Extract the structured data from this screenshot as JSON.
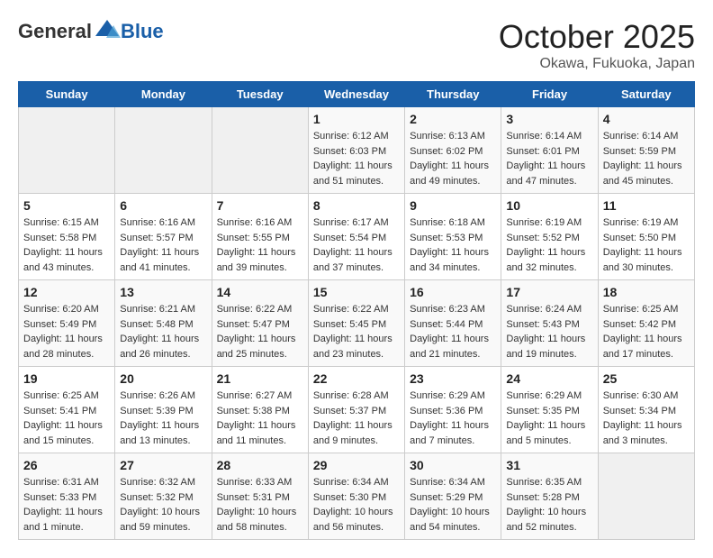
{
  "header": {
    "logo_general": "General",
    "logo_blue": "Blue",
    "month": "October 2025",
    "location": "Okawa, Fukuoka, Japan"
  },
  "weekdays": [
    "Sunday",
    "Monday",
    "Tuesday",
    "Wednesday",
    "Thursday",
    "Friday",
    "Saturday"
  ],
  "weeks": [
    [
      {
        "day": "",
        "info": ""
      },
      {
        "day": "",
        "info": ""
      },
      {
        "day": "",
        "info": ""
      },
      {
        "day": "1",
        "info": "Sunrise: 6:12 AM\nSunset: 6:03 PM\nDaylight: 11 hours\nand 51 minutes."
      },
      {
        "day": "2",
        "info": "Sunrise: 6:13 AM\nSunset: 6:02 PM\nDaylight: 11 hours\nand 49 minutes."
      },
      {
        "day": "3",
        "info": "Sunrise: 6:14 AM\nSunset: 6:01 PM\nDaylight: 11 hours\nand 47 minutes."
      },
      {
        "day": "4",
        "info": "Sunrise: 6:14 AM\nSunset: 5:59 PM\nDaylight: 11 hours\nand 45 minutes."
      }
    ],
    [
      {
        "day": "5",
        "info": "Sunrise: 6:15 AM\nSunset: 5:58 PM\nDaylight: 11 hours\nand 43 minutes."
      },
      {
        "day": "6",
        "info": "Sunrise: 6:16 AM\nSunset: 5:57 PM\nDaylight: 11 hours\nand 41 minutes."
      },
      {
        "day": "7",
        "info": "Sunrise: 6:16 AM\nSunset: 5:55 PM\nDaylight: 11 hours\nand 39 minutes."
      },
      {
        "day": "8",
        "info": "Sunrise: 6:17 AM\nSunset: 5:54 PM\nDaylight: 11 hours\nand 37 minutes."
      },
      {
        "day": "9",
        "info": "Sunrise: 6:18 AM\nSunset: 5:53 PM\nDaylight: 11 hours\nand 34 minutes."
      },
      {
        "day": "10",
        "info": "Sunrise: 6:19 AM\nSunset: 5:52 PM\nDaylight: 11 hours\nand 32 minutes."
      },
      {
        "day": "11",
        "info": "Sunrise: 6:19 AM\nSunset: 5:50 PM\nDaylight: 11 hours\nand 30 minutes."
      }
    ],
    [
      {
        "day": "12",
        "info": "Sunrise: 6:20 AM\nSunset: 5:49 PM\nDaylight: 11 hours\nand 28 minutes."
      },
      {
        "day": "13",
        "info": "Sunrise: 6:21 AM\nSunset: 5:48 PM\nDaylight: 11 hours\nand 26 minutes."
      },
      {
        "day": "14",
        "info": "Sunrise: 6:22 AM\nSunset: 5:47 PM\nDaylight: 11 hours\nand 25 minutes."
      },
      {
        "day": "15",
        "info": "Sunrise: 6:22 AM\nSunset: 5:45 PM\nDaylight: 11 hours\nand 23 minutes."
      },
      {
        "day": "16",
        "info": "Sunrise: 6:23 AM\nSunset: 5:44 PM\nDaylight: 11 hours\nand 21 minutes."
      },
      {
        "day": "17",
        "info": "Sunrise: 6:24 AM\nSunset: 5:43 PM\nDaylight: 11 hours\nand 19 minutes."
      },
      {
        "day": "18",
        "info": "Sunrise: 6:25 AM\nSunset: 5:42 PM\nDaylight: 11 hours\nand 17 minutes."
      }
    ],
    [
      {
        "day": "19",
        "info": "Sunrise: 6:25 AM\nSunset: 5:41 PM\nDaylight: 11 hours\nand 15 minutes."
      },
      {
        "day": "20",
        "info": "Sunrise: 6:26 AM\nSunset: 5:39 PM\nDaylight: 11 hours\nand 13 minutes."
      },
      {
        "day": "21",
        "info": "Sunrise: 6:27 AM\nSunset: 5:38 PM\nDaylight: 11 hours\nand 11 minutes."
      },
      {
        "day": "22",
        "info": "Sunrise: 6:28 AM\nSunset: 5:37 PM\nDaylight: 11 hours\nand 9 minutes."
      },
      {
        "day": "23",
        "info": "Sunrise: 6:29 AM\nSunset: 5:36 PM\nDaylight: 11 hours\nand 7 minutes."
      },
      {
        "day": "24",
        "info": "Sunrise: 6:29 AM\nSunset: 5:35 PM\nDaylight: 11 hours\nand 5 minutes."
      },
      {
        "day": "25",
        "info": "Sunrise: 6:30 AM\nSunset: 5:34 PM\nDaylight: 11 hours\nand 3 minutes."
      }
    ],
    [
      {
        "day": "26",
        "info": "Sunrise: 6:31 AM\nSunset: 5:33 PM\nDaylight: 11 hours\nand 1 minute."
      },
      {
        "day": "27",
        "info": "Sunrise: 6:32 AM\nSunset: 5:32 PM\nDaylight: 10 hours\nand 59 minutes."
      },
      {
        "day": "28",
        "info": "Sunrise: 6:33 AM\nSunset: 5:31 PM\nDaylight: 10 hours\nand 58 minutes."
      },
      {
        "day": "29",
        "info": "Sunrise: 6:34 AM\nSunset: 5:30 PM\nDaylight: 10 hours\nand 56 minutes."
      },
      {
        "day": "30",
        "info": "Sunrise: 6:34 AM\nSunset: 5:29 PM\nDaylight: 10 hours\nand 54 minutes."
      },
      {
        "day": "31",
        "info": "Sunrise: 6:35 AM\nSunset: 5:28 PM\nDaylight: 10 hours\nand 52 minutes."
      },
      {
        "day": "",
        "info": ""
      }
    ]
  ]
}
